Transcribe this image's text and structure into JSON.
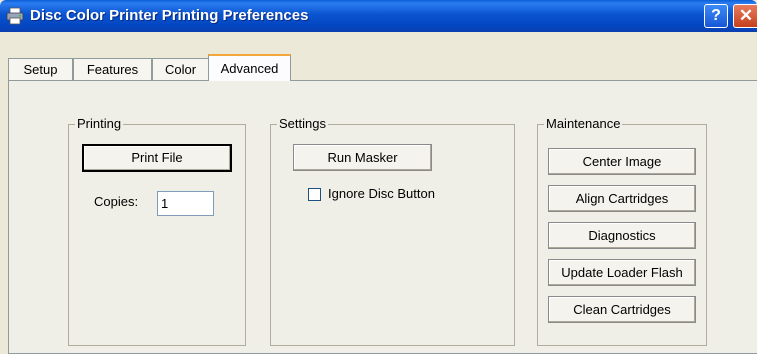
{
  "window": {
    "title": "Disc Color Printer Printing Preferences",
    "help_label": "?",
    "close_label": "✕",
    "accent": "#0a54d0"
  },
  "tabs": [
    {
      "label": "Setup",
      "active": false
    },
    {
      "label": "Features",
      "active": false
    },
    {
      "label": "Color",
      "active": false
    },
    {
      "label": "Advanced",
      "active": true
    }
  ],
  "printing": {
    "title": "Printing",
    "print_file_label": "Print File",
    "copies_label": "Copies:",
    "copies_value": "1"
  },
  "settings": {
    "title": "Settings",
    "run_masker_label": "Run Masker",
    "ignore_disc_button_label": "Ignore Disc Button",
    "ignore_disc_button_checked": false
  },
  "maintenance": {
    "title": "Maintenance",
    "buttons": [
      {
        "label": "Center Image"
      },
      {
        "label": "Align Cartridges"
      },
      {
        "label": "Diagnostics"
      },
      {
        "label": "Update Loader Flash"
      },
      {
        "label": "Clean Cartridges"
      }
    ]
  }
}
